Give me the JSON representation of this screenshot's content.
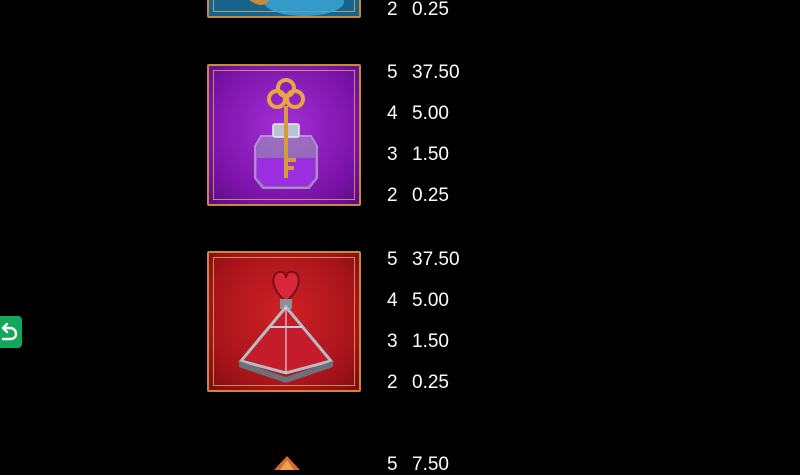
{
  "paytable": {
    "symbols": [
      {
        "name": "blue-symbol-partial",
        "background": "#1a6f9a",
        "rows": [
          {
            "count": "2",
            "payout": "0.25"
          }
        ]
      },
      {
        "name": "purple-club-potion",
        "background": "#8a1fb7",
        "rows": [
          {
            "count": "5",
            "payout": "37.50"
          },
          {
            "count": "4",
            "payout": "5.00"
          },
          {
            "count": "3",
            "payout": "1.50"
          },
          {
            "count": "2",
            "payout": "0.25"
          }
        ]
      },
      {
        "name": "red-heart-potion",
        "background": "#b3181a",
        "rows": [
          {
            "count": "5",
            "payout": "37.50"
          },
          {
            "count": "4",
            "payout": "5.00"
          },
          {
            "count": "3",
            "payout": "1.50"
          },
          {
            "count": "2",
            "payout": "0.25"
          }
        ]
      },
      {
        "name": "next-symbol-partial",
        "rows": [
          {
            "count": "5",
            "payout": "7.50"
          }
        ]
      }
    ]
  },
  "controls": {
    "back_icon": "undo-arrow-icon",
    "back_color": "#12a85a"
  },
  "colors": {
    "frame_gold": "#c9883c",
    "background": "#000000",
    "text": "#ffffff"
  }
}
